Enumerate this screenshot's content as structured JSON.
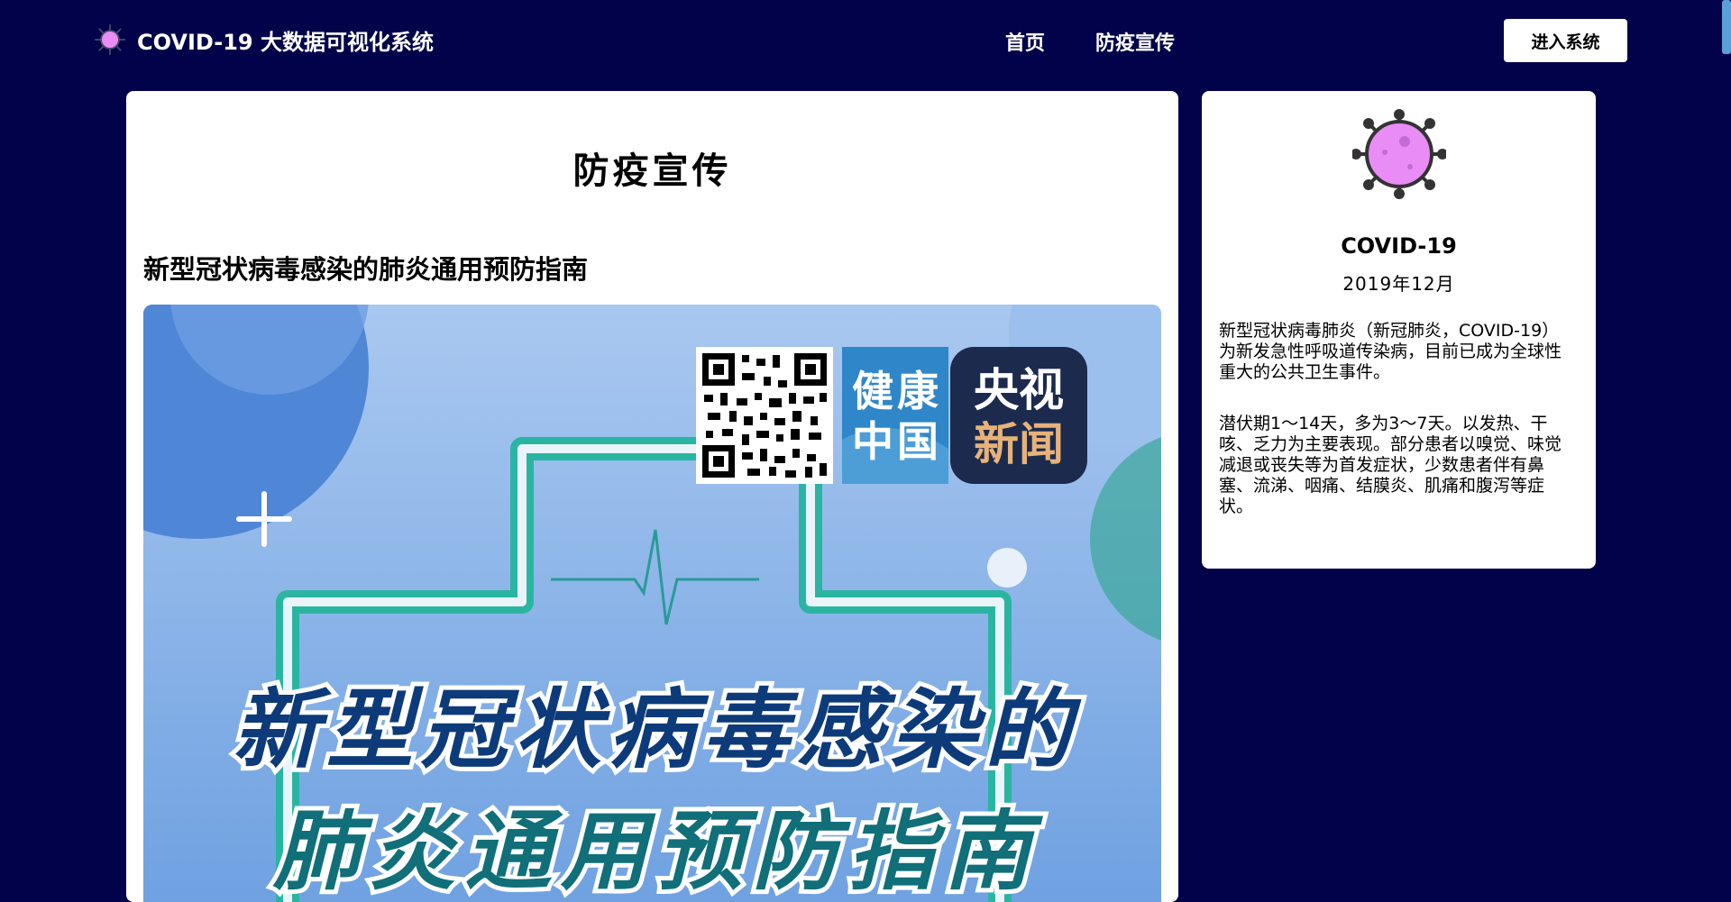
{
  "header": {
    "title": "COVID-19 大数据可视化系统",
    "nav": [
      {
        "label": "首页"
      },
      {
        "label": "防疫宣传"
      }
    ],
    "enter_button": "进入系统",
    "logo_icon": "virus-icon"
  },
  "main": {
    "page_title": "防疫宣传",
    "article_title": "新型冠状病毒感染的肺炎通用预防指南",
    "poster": {
      "badge_1": "健康中国",
      "badge_2_line1": "央视",
      "badge_2_line2": "新闻",
      "headline_line1": "新型冠状病毒感染的",
      "headline_line2": "肺炎通用预防指南"
    }
  },
  "sidebar": {
    "icon": "virus-icon",
    "name": "COVID-19",
    "date": "2019年12月",
    "paragraph_1": "新型冠状病毒肺炎（新冠肺炎，COVID-19）为新发急性呼吸道传染病，目前已成为全球性重大的公共卫生事件。",
    "paragraph_2": "潜伏期1～14天，多为3～7天。以发热、干咳、乏力为主要表现。部分患者以嗅觉、味觉减退或丧失等为首发症状，少数患者伴有鼻塞、流涕、咽痛、结膜炎、肌痛和腹泻等症状。"
  },
  "colors": {
    "background": "#02024a",
    "card": "#ffffff",
    "virus_purple": "#e98cf5",
    "poster_blue": "#7faee8",
    "poster_teal": "#2ab5a2"
  }
}
